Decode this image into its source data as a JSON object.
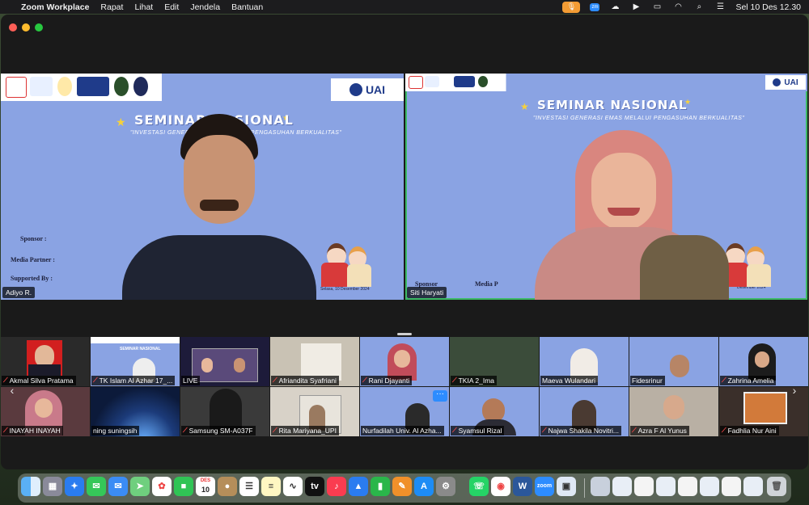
{
  "menubar": {
    "apple": "",
    "app_name": "Zoom Workplace",
    "items": [
      "Rapat",
      "Lihat",
      "Edit",
      "Jendela",
      "Bantuan"
    ],
    "clock": "Sel 10 Des  12.30",
    "zoom_badge": "zm"
  },
  "speakers": [
    {
      "name": "Adiyo R.",
      "title": "SEMINAR NASIONAL",
      "subtitle": "\"INVESTASI GENERASI EMAS MELALUI PENGASUHAN BERKUALITAS\"",
      "side_labels": [
        "Sponsor :",
        "Media Partner :",
        "Supported By :"
      ],
      "date_text": "Selasa, 10 Desember 2024",
      "logo_text": "UAI"
    },
    {
      "name": "Siti Haryati",
      "title": "SEMINAR NASIONAL",
      "subtitle": "\"INVESTASI GENERASI EMAS MELALUI PENGASUHAN BERKUALITAS\"",
      "side_labels": [
        "Sponsor",
        "Media P"
      ],
      "date_text": "Desember 2024",
      "logo_text": "UAI"
    }
  ],
  "participants_row1": [
    {
      "name": "Akmal Silva Pratama",
      "muted": true,
      "bg": "#2a2a2a"
    },
    {
      "name": "TK Islam Al Azhar 17_...",
      "muted": true,
      "bg": "#8aa3e3"
    },
    {
      "name": "LIVE",
      "muted": false,
      "bg": "#1d1b3a"
    },
    {
      "name": "Afriandita Syafriani",
      "muted": true,
      "bg": "#c9c2b4"
    },
    {
      "name": "Rani Djayanti",
      "muted": true,
      "bg": "#8aa3e3"
    },
    {
      "name": "TKIA 2_Ima",
      "muted": true,
      "bg": "#3b4c3a"
    },
    {
      "name": "Maeva Wulandari",
      "muted": false,
      "bg": "#8aa3e3"
    },
    {
      "name": "Fidesrinur",
      "muted": false,
      "bg": "#8aa3e3"
    },
    {
      "name": "Zahrina Amelia",
      "muted": true,
      "bg": "#8aa3e3"
    }
  ],
  "participants_row2": [
    {
      "name": "INAYAH INAYAH",
      "muted": true,
      "bg": "#5a3a3e"
    },
    {
      "name": "ning suningsih",
      "muted": false,
      "bg": "#0c1a3a"
    },
    {
      "name": "Samsung SM-A037F",
      "muted": true,
      "bg": "#3a3a3a"
    },
    {
      "name": "Rita Mariyana_UPI",
      "muted": true,
      "bg": "#d8d2c8"
    },
    {
      "name": "Nurfadilah Univ. Al Azha...",
      "muted": false,
      "bg": "#8aa3e3"
    },
    {
      "name": "Syamsul Rizal",
      "muted": true,
      "bg": "#8aa3e3"
    },
    {
      "name": "Najwa Shakila Novitri...",
      "muted": true,
      "bg": "#8aa3e3"
    },
    {
      "name": "Azra F Al Yunus",
      "muted": true,
      "bg": "#b9b0a4"
    },
    {
      "name": "Fadhlia Nur Aini",
      "muted": true,
      "bg": "#3a2f2a"
    }
  ],
  "gallery_nav": {
    "left": "‹",
    "right": "›",
    "more": "···"
  },
  "dock": {
    "calendar_month": "DES",
    "calendar_day": "10",
    "icons": [
      "finder-icon",
      "launchpad-icon",
      "safari-icon",
      "messages-icon",
      "mail-icon",
      "maps-icon",
      "photos-icon",
      "facetime-icon",
      "calendar-icon",
      "contacts-icon",
      "reminders-icon",
      "notes-icon",
      "freeform-icon",
      "appletv-icon",
      "music-icon",
      "keynote-icon",
      "numbers-icon",
      "pages-icon",
      "appstore-icon",
      "settings-icon",
      "whatsapp-icon",
      "chrome-icon",
      "word-icon",
      "zoom-icon",
      "preview-icon"
    ]
  }
}
